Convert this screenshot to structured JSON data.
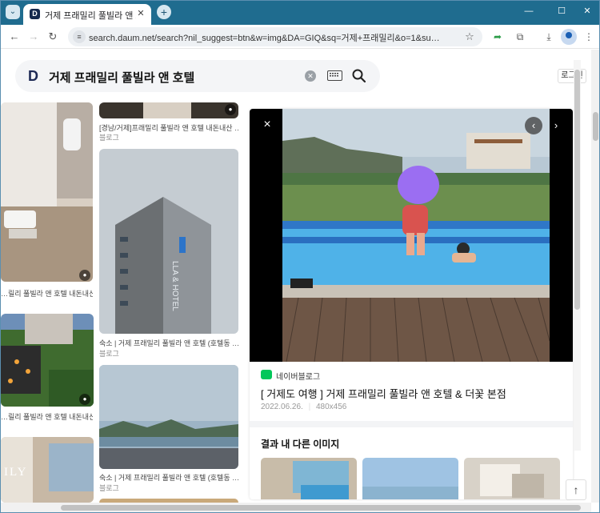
{
  "browser": {
    "tab_title": "거제 프래밀리 풀빌라 앤 호텔",
    "url": "search.daum.net/search?nil_suggest=btn&w=img&DA=GIQ&sq=거제+프래밀리&o=1&sugo=5&q=거...",
    "tab_favicon_letter": "D"
  },
  "search": {
    "logo_letter": "D",
    "query": "거제 프래밀리 풀빌라 앤 호텔",
    "login_label": "로그인"
  },
  "results": {
    "col_a": [
      {
        "caption": "…릴리 풀빌라 앤 호텔 내돈내산 …"
      },
      {
        "caption": "…릴리 풀빌라 앤 호텔 내돈내산 …"
      }
    ],
    "col_b": [
      {
        "caption": "[경남/거제]프래밀리 풀빌라 앤 호텔 내돈내산 …",
        "source": "블로그"
      },
      {
        "caption": "숙소 | 거제 프래밀리 풀빌라 앤 호텔 (호텔동 …",
        "source": "블로그"
      },
      {
        "caption": "숙소 | 거제 프래밀리 풀빌라 앤 호텔 (호텔동 …",
        "source": "블로그"
      }
    ]
  },
  "detail": {
    "source_name": "네이버블로그",
    "title": "[ 거제도 여행 ] 거제 프래밀리 풀빌라 앤 호텔 & 더꽃 본점",
    "date": "2022.06.26.",
    "size": "480x456",
    "similar_heading": "결과 내 다른 이미지"
  },
  "icons": {
    "close": "×",
    "prev": "‹",
    "next": "›",
    "scroll_top": "↑",
    "pin": "⚲"
  },
  "colors": {
    "tab_strip": "#1f6c8f",
    "naver_green": "#03c75a",
    "daum_navy": "#1e2a55"
  }
}
